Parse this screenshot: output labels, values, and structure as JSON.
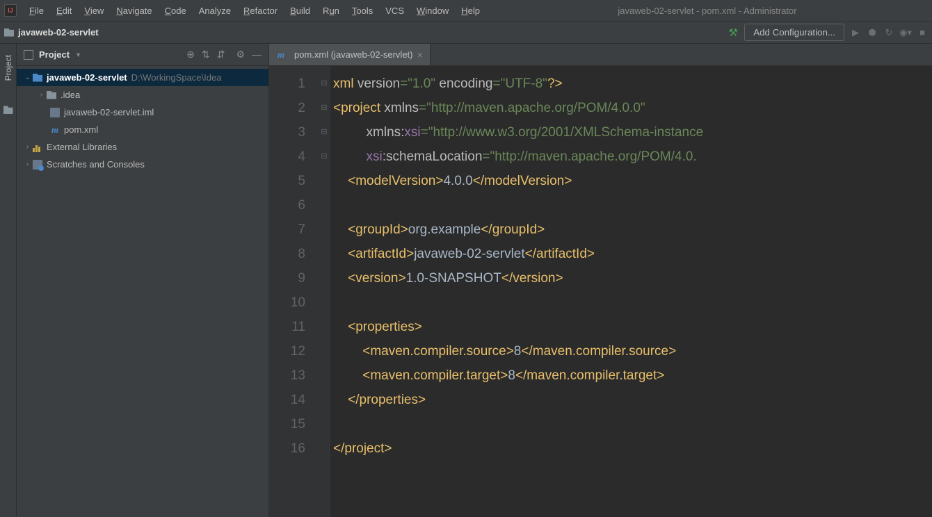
{
  "menu": {
    "file": "File",
    "edit": "Edit",
    "view": "View",
    "navigate": "Navigate",
    "code": "Code",
    "analyze": "Analyze",
    "refactor": "Refactor",
    "build": "Build",
    "run": "Run",
    "tools": "Tools",
    "vcs": "VCS",
    "window": "Window",
    "help": "Help"
  },
  "window_title": "javaweb-02-servlet - pom.xml - Administrator",
  "breadcrumb": {
    "project": "javaweb-02-servlet"
  },
  "add_config": "Add Configuration...",
  "side": {
    "title": "Project",
    "gutter": "Project"
  },
  "tree": {
    "root": {
      "name": "javaweb-02-servlet",
      "path": "D:\\WorkingSpace\\Idea"
    },
    "idea": ".idea",
    "iml": "javaweb-02-servlet.iml",
    "pom": "pom.xml",
    "ext": "External Libraries",
    "scratch": "Scratches and Consoles"
  },
  "tab": {
    "label": "pom.xml (javaweb-02-servlet)"
  },
  "lines": [
    "1",
    "2",
    "3",
    "4",
    "5",
    "6",
    "7",
    "8",
    "9",
    "10",
    "11",
    "12",
    "13",
    "14",
    "15",
    "16"
  ],
  "fold": {
    "l2": "⊟",
    "l11": "⊟",
    "l14": "⊟",
    "l16": "⊟"
  },
  "code": {
    "xml_decl": {
      "open": "<?",
      "xml": "xml ",
      "version": "version",
      "eq": "=",
      "v": "\"1.0\"",
      "sp": " ",
      "encoding": "encoding",
      "enc": "\"UTF-8\"",
      "close": "?>"
    },
    "project_open": "<",
    "project": "project ",
    "xmlns": "xmlns",
    "proj_ns": "\"http://maven.apache.org/POM/4.0.0\"",
    "xmlns_xsi_pre": "xmlns:",
    "xsi": "xsi",
    "xsi_ns": "\"http://www.w3.org/2001/XMLSchema-instance",
    "xsi_pre": "xsi",
    "schemaLoc": ":schemaLocation",
    "schema_val": "\"http://maven.apache.org/POM/4.0.",
    "mv_open": "<modelVersion>",
    "mv": "4.0.0",
    "mv_close": "</modelVersion>",
    "gid_open": "<groupId>",
    "gid": "org.example",
    "gid_close": "</groupId>",
    "aid_open": "<artifactId>",
    "aid": "javaweb-02-servlet",
    "aid_close": "</artifactId>",
    "ver_open": "<version>",
    "ver": "1.0-SNAPSHOT",
    "ver_close": "</version>",
    "props_open": "<properties>",
    "src_open": "<maven.compiler.source>",
    "src": "8",
    "src_close": "</maven.compiler.source>",
    "tgt_open": "<maven.compiler.target>",
    "tgt": "8",
    "tgt_close": "</maven.compiler.target>",
    "props_close": "</properties>",
    "project_close": "</project>"
  }
}
